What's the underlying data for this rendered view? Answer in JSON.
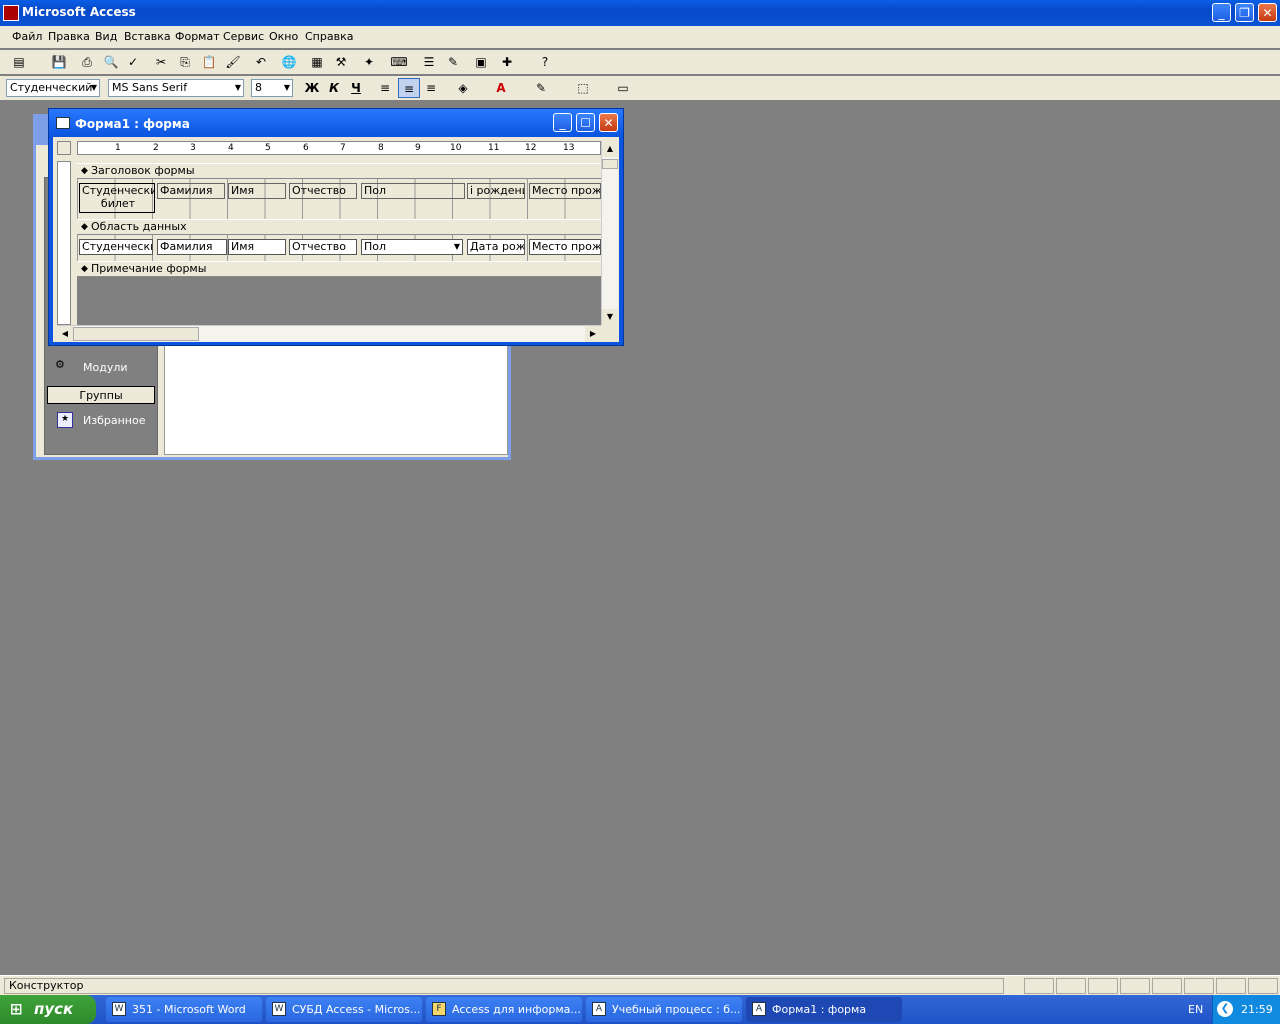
{
  "app": {
    "title": "Microsoft Access"
  },
  "menu": [
    "Файл",
    "Правка",
    "Вид",
    "Вставка",
    "Формат",
    "Сервис",
    "Окно",
    "Справка"
  ],
  "formatting": {
    "object_combo": "Студенческий",
    "font_combo": "MS Sans Serif",
    "size_combo": "8",
    "bold": "Ж",
    "italic": "К",
    "underline": "Ч"
  },
  "db_window": {
    "items": [
      {
        "label": "Модули",
        "icon": "modules-icon"
      }
    ],
    "groups_label": "Группы",
    "favorites_label": "Избранное"
  },
  "form_window": {
    "title": "Форма1 : форма",
    "ruler": [
      "1",
      "2",
      "3",
      "4",
      "5",
      "6",
      "7",
      "8",
      "9",
      "10",
      "11",
      "12",
      "13"
    ],
    "sections": {
      "header": "Заголовок формы",
      "detail": "Область данных",
      "footer": "Примечание формы"
    },
    "header_labels": [
      "Студенческий билет",
      "Фамилия",
      "Имя",
      "Отчество",
      "Пол",
      "і рождения",
      "Место прожи"
    ],
    "detail_fields": [
      "Студенческий",
      "Фамилия",
      "Имя",
      "Отчество",
      "Пол",
      "Дата рожд",
      "Место прожи"
    ]
  },
  "status": {
    "text": "Конструктор"
  },
  "taskbar": {
    "start": "пуск",
    "buttons": [
      {
        "label": "351 - Microsoft Word",
        "icon": "W"
      },
      {
        "label": "СУБД Access - Micros...",
        "icon": "W"
      },
      {
        "label": "Access для информа...",
        "icon": "F"
      },
      {
        "label": "Учебный процесс : б...",
        "icon": "A"
      },
      {
        "label": "Форма1 : форма",
        "icon": "A"
      }
    ],
    "lang": "EN",
    "clock": "21:59"
  }
}
